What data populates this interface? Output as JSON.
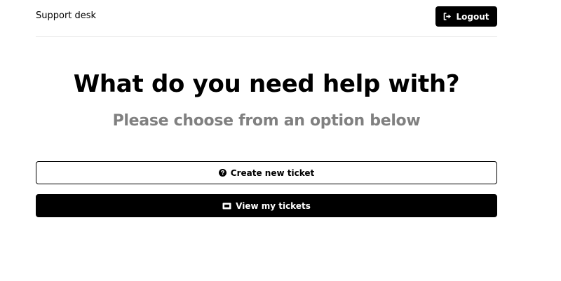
{
  "header": {
    "brand": "Support desk",
    "logout_label": "Logout",
    "logout_icon": "sign-out-icon"
  },
  "main": {
    "heading": "What do you need help with?",
    "subheading": "Please choose from an option below",
    "create_ticket_label": "Create new ticket",
    "create_ticket_icon": "question-circle-icon",
    "view_tickets_label": "View my tickets",
    "view_tickets_icon": "ticket-icon"
  },
  "colors": {
    "primary": "#000000",
    "background": "#ffffff",
    "subheading": "#808080",
    "divider": "#e6e6e6"
  }
}
